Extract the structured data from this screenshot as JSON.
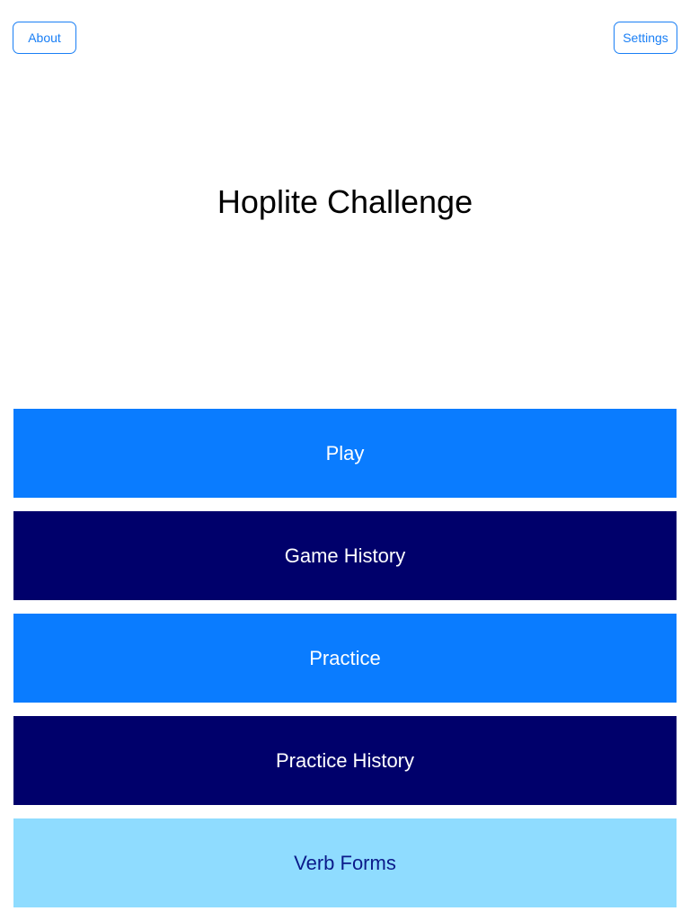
{
  "header": {
    "about_label": "About",
    "settings_label": "Settings"
  },
  "app": {
    "title": "Hoplite Challenge"
  },
  "menu": {
    "items": [
      {
        "label": "Play",
        "style": "light"
      },
      {
        "label": "Game History",
        "style": "dark"
      },
      {
        "label": "Practice",
        "style": "light"
      },
      {
        "label": "Practice History",
        "style": "dark"
      },
      {
        "label": "Verb Forms",
        "style": "pale"
      }
    ]
  },
  "colors": {
    "accent": "#1a7ff5",
    "button_light": "#0a7cff",
    "button_dark": "#00006b",
    "button_pale": "#8fdcff",
    "pale_text": "#0b1a8a"
  }
}
